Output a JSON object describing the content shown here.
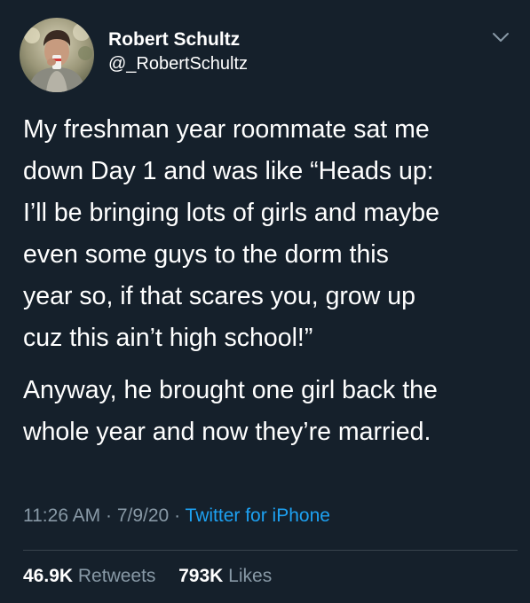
{
  "author": {
    "name": "Robert Schultz",
    "handle": "@_RobertSchultz"
  },
  "icons": {
    "avatar": "avatar-photo",
    "menu": "chevron-down-icon"
  },
  "tweet": {
    "paragraph_1": "My freshman year roommate sat me\ndown Day 1 and was like “Heads up:\nI’ll be bringing lots of girls and maybe\neven some guys to the dorm this\nyear so, if that scares you, grow up\ncuz this ain’t high school!”",
    "paragraph_2": "Anyway, he brought one girl back the\nwhole year and now they’re married."
  },
  "meta": {
    "time": "11:26 AM",
    "sep1": " · ",
    "date": "7/9/20",
    "sep2": " · ",
    "source": "Twitter for iPhone"
  },
  "stats": {
    "retweets_count": "46.9K",
    "retweets_label": "Retweets",
    "likes_count": "793K",
    "likes_label": "Likes"
  },
  "colors": {
    "background": "#15202b",
    "text": "#ffffff",
    "secondary": "#8899a6",
    "link": "#1da1f2",
    "divider": "#38444d"
  }
}
